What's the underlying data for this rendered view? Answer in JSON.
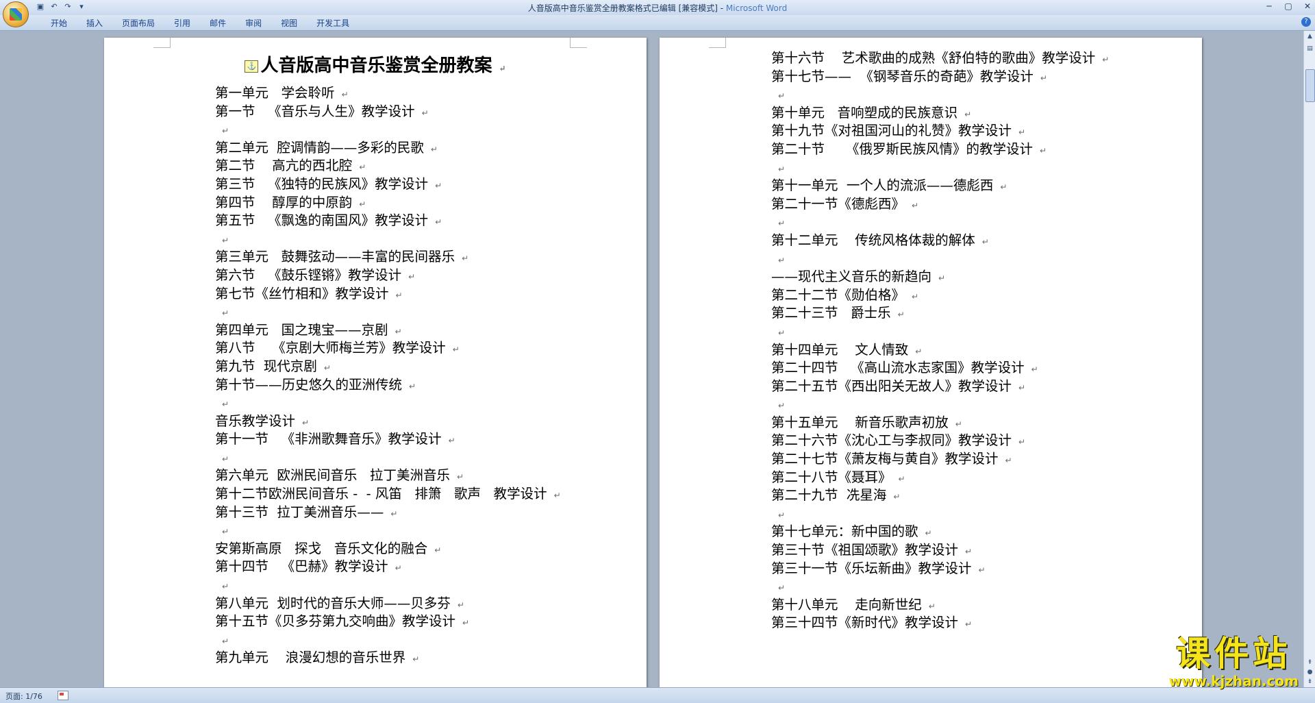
{
  "window": {
    "title": "人音版高中音乐鉴赏全册教案格式已编辑 [兼容模式] - ",
    "app_name": "Microsoft Word",
    "controls": [
      "─",
      "▢",
      "✕"
    ]
  },
  "quick_access": [
    "save-icon",
    "undo-icon",
    "redo-icon",
    "customize-icon"
  ],
  "ribbon": {
    "tabs": [
      "开始",
      "插入",
      "页面布局",
      "引用",
      "邮件",
      "审阅",
      "视图",
      "开发工具"
    ]
  },
  "document": {
    "title": "人音版高中音乐鉴赏全册教案",
    "page1_lines": [
      "第一单元   学会聆听",
      "第一节   《音乐与人生》教学设计",
      "",
      "第二单元  腔调情韵——多彩的民歌",
      "第二节    高亢的西北腔",
      "第三节   《独特的民族风》教学设计",
      "第四节    醇厚的中原韵",
      "第五节   《飘逸的南国风》教学设计",
      "",
      "第三单元   鼓舞弦动——丰富的民间器乐",
      "第六节   《鼓乐铿锵》教学设计",
      "第七节《丝竹相和》教学设计",
      "",
      "第四单元   国之瑰宝——京剧",
      "第八节    《京剧大师梅兰芳》教学设计",
      "第九节  现代京剧",
      "第十节——历史悠久的亚洲传统",
      "",
      "音乐教学设计",
      "第十一节   《非洲歌舞音乐》教学设计",
      "",
      "第六单元  欧洲民间音乐   拉丁美洲音乐",
      "第十二节欧洲民间音乐 -  - 风笛   排箫   歌声   教学设计",
      "第十三节  拉丁美洲音乐——",
      "",
      "安第斯高原   探戈   音乐文化的融合",
      "第十四节   《巴赫》教学设计",
      "",
      "第八单元  划时代的音乐大师——贝多芬",
      "第十五节《贝多芬第九交响曲》教学设计",
      "",
      "第九单元    浪漫幻想的音乐世界"
    ],
    "page2_lines": [
      "第十六节    艺术歌曲的成熟《舒伯特的歌曲》教学设计",
      "第十七节——  《钢琴音乐的奇葩》教学设计",
      "",
      "第十单元   音响塑成的民族意识",
      "第十九节《对祖国河山的礼赞》教学设计",
      "第二十节     《俄罗斯民族风情》的教学设计",
      "",
      "第十一单元  一个人的流派——德彪西",
      "第二十一节《德彪西》",
      "",
      "第十二单元    传统风格体裁的解体",
      "",
      "——现代主义音乐的新趋向",
      "第二十二节《勋伯格》",
      "第二十三节   爵士乐",
      "",
      "第十四单元    文人情致",
      "第二十四节   《高山流水志家国》教学设计",
      "第二十五节《西出阳关无故人》教学设计",
      "",
      "第十五单元    新音乐歌声初放",
      "第二十六节《沈心工与李叔同》教学设计",
      "第二十七节《萧友梅与黄自》教学设计",
      "第二十八节《聂耳》",
      "第二十九节  冼星海",
      "",
      "第十七单元：新中国的歌",
      "第三十节《祖国颂歌》教学设计",
      "第三十一节《乐坛新曲》教学设计",
      "",
      "第十八单元    走向新世纪",
      "第三十四节《新时代》教学设计"
    ],
    "paragraph_mark": "↵"
  },
  "status_bar": {
    "page_info": "页面: 1/76"
  },
  "watermark": {
    "text": "课件站",
    "url": "www.kjzhan.com"
  },
  "colors": {
    "ribbon_text": "#15428b",
    "app_name": "#4a7cc0",
    "watermark": "#f5e41c"
  }
}
